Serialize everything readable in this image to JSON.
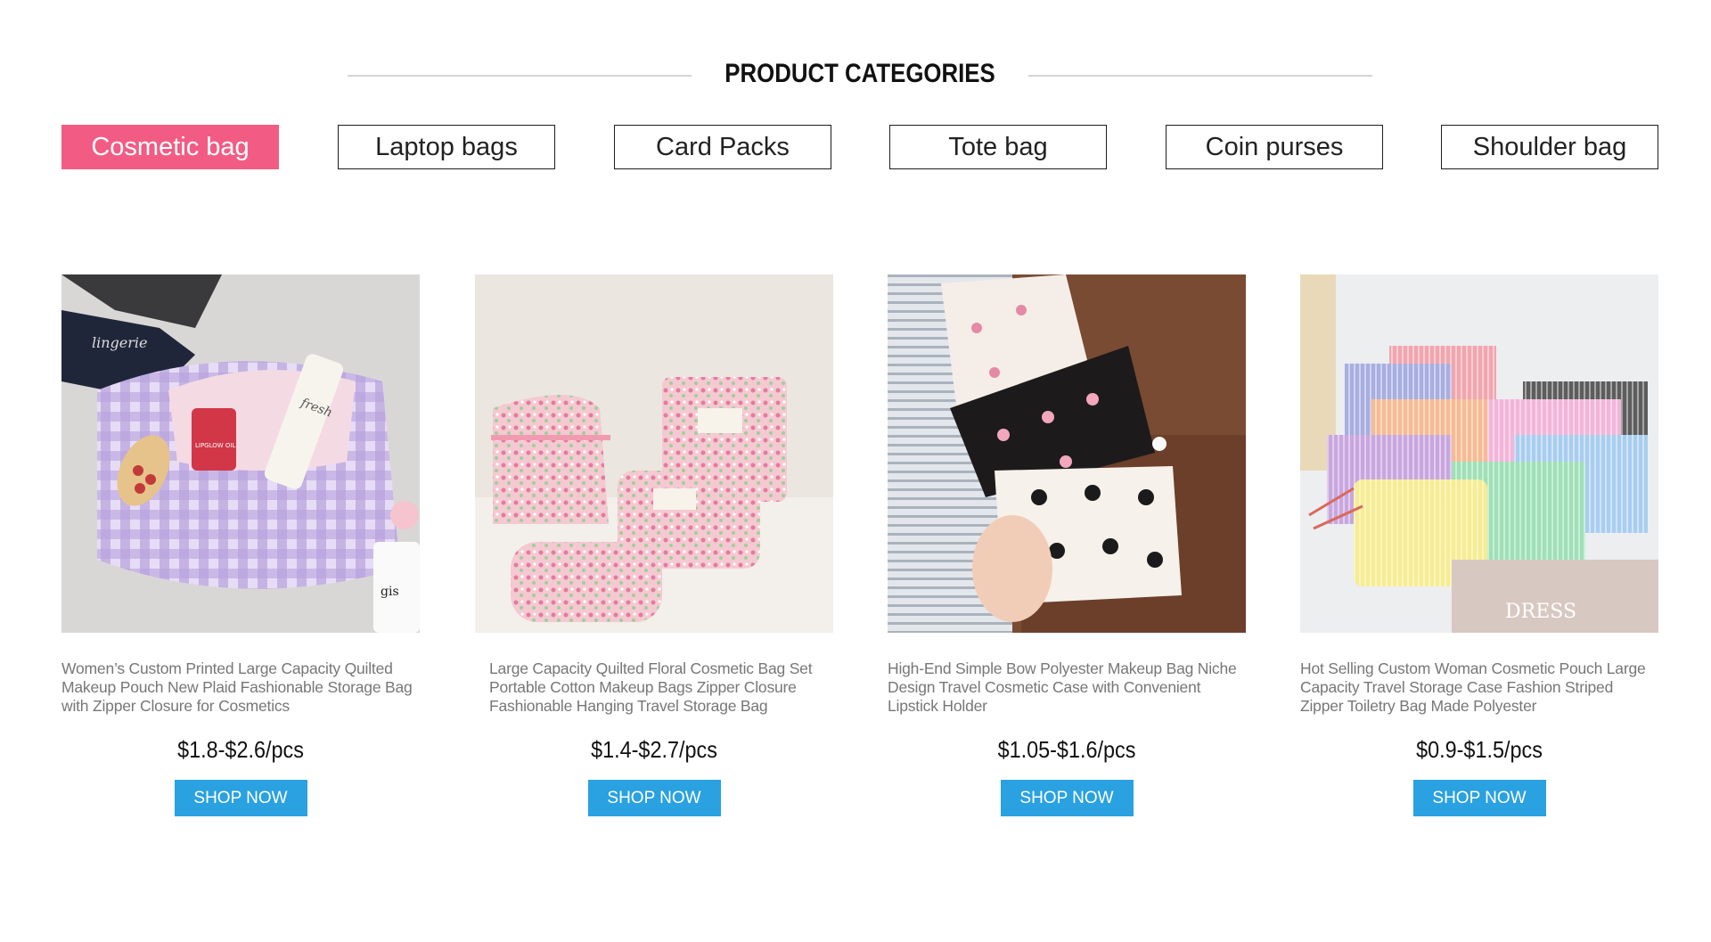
{
  "section": {
    "title": "PRODUCT CATEGORIES"
  },
  "tabs": [
    {
      "label": "Cosmetic bag"
    },
    {
      "label": "Laptop bags"
    },
    {
      "label": "Card Packs"
    },
    {
      "label": "Tote bag"
    },
    {
      "label": "Coin purses"
    },
    {
      "label": "Shoulder bag"
    }
  ],
  "active_tab": "Cosmetic bag",
  "products": [
    {
      "title": "Women’s Custom Printed Large Capacity Quilted Makeup Pouch New Plaid Fashionable Storage Bag with Zipper Closure for Cosmetics",
      "price": "$1.8-$2.6/pcs",
      "button": "SHOP NOW",
      "image_text": {
        "box": "lingerie",
        "tube": "fresh",
        "bottle": "LIPGLOW OIL",
        "jar": "gis"
      }
    },
    {
      "title": "Large Capacity Quilted Floral Cosmetic Bag Set Portable Cotton Makeup Bags Zipper Closure Fashionable Hanging Travel Storage Bag",
      "price": "$1.4-$2.7/pcs",
      "button": "SHOP NOW"
    },
    {
      "title": "High-End Simple Bow Polyester Makeup Bag Niche Design Travel Cosmetic Case with Convenient Lipstick Holder",
      "price": "$1.05-$1.6/pcs",
      "button": "SHOP NOW"
    },
    {
      "title": "Hot Selling Custom Woman Cosmetic Pouch Large Capacity Travel Storage Case Fashion Striped Zipper Toiletry Bag Made Polyester",
      "price": "$0.9-$1.5/pcs",
      "button": "SHOP NOW",
      "image_text": {
        "magazine": "DRESS"
      }
    }
  ],
  "colors": {
    "accent_tab": "#f25c84",
    "button": "#2aa1e0",
    "title_gray": "#777777"
  }
}
